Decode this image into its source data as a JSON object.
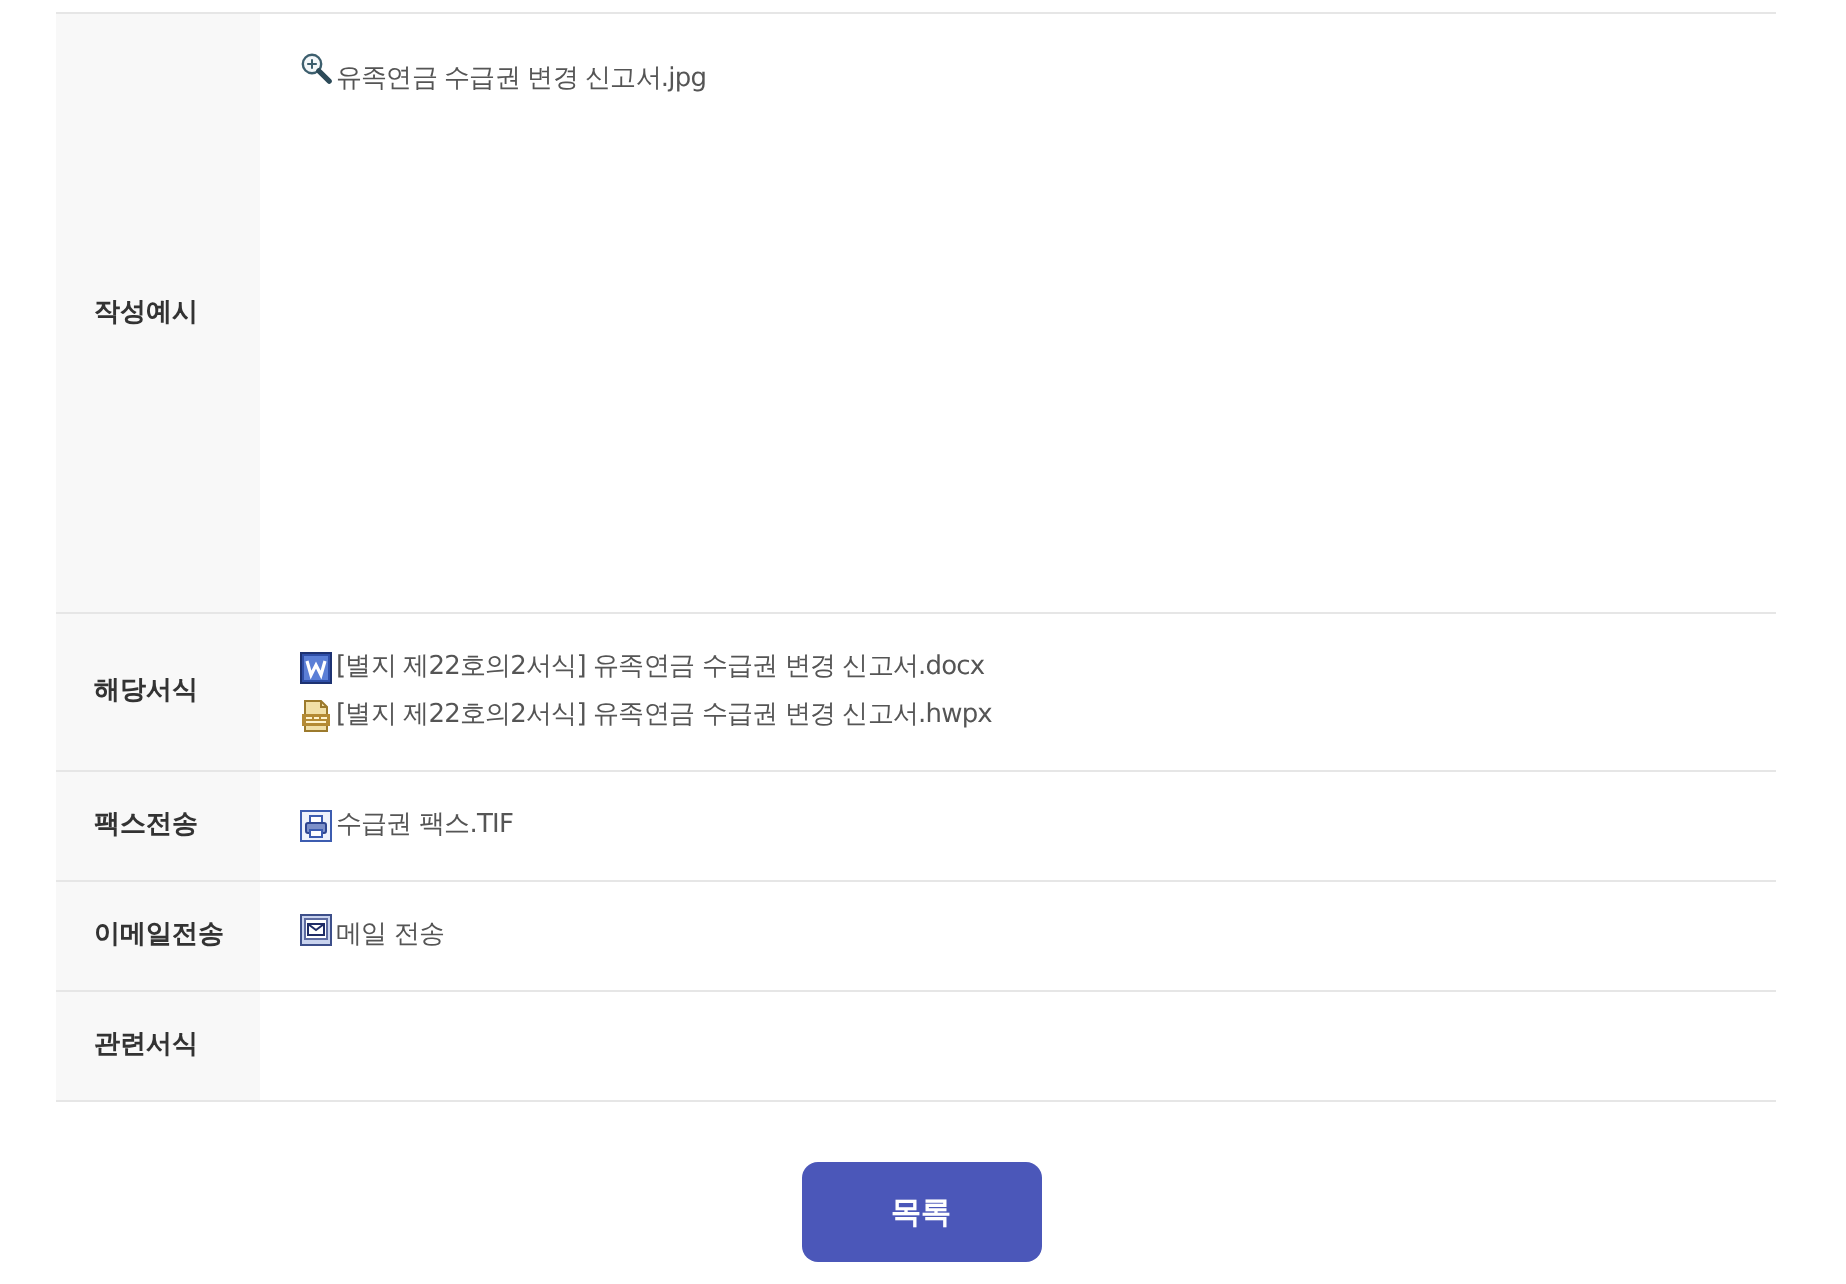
{
  "rows": [
    {
      "label": "작성예시",
      "files": [
        {
          "kind": "preview",
          "name": "유족연금 수급권 변경 신고서.jpg"
        }
      ]
    },
    {
      "label": "해당서식",
      "files": [
        {
          "kind": "doc",
          "name": "[별지 제22호의2서식] 유족연금 수급권 변경 신고서.docx"
        },
        {
          "kind": "etc",
          "name": "[별지 제22호의2서식] 유족연금 수급권 변경 신고서.hwpx"
        }
      ]
    },
    {
      "label": "팩스전송",
      "files": [
        {
          "kind": "fax",
          "name": "수급권 팩스.TIF"
        }
      ]
    },
    {
      "label": "이메일전송",
      "files": [
        {
          "kind": "mail",
          "name": "메일 전송"
        }
      ]
    },
    {
      "label": "관련서식"
    }
  ],
  "button": {
    "label": "목록"
  }
}
